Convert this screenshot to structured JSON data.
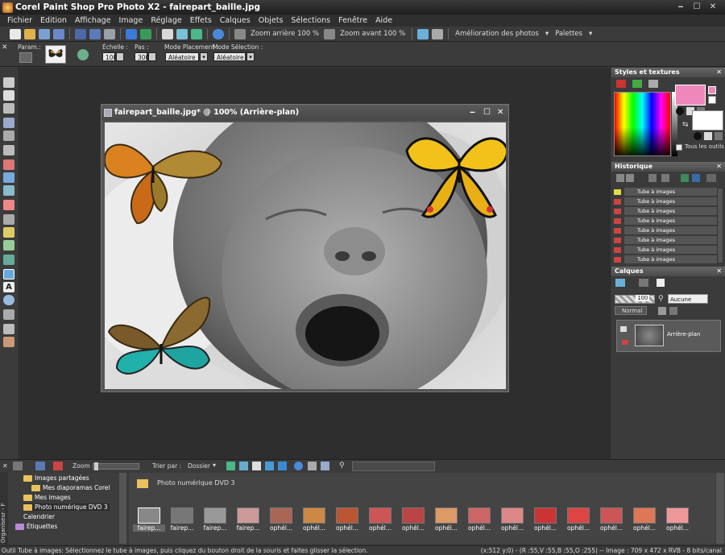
{
  "app": {
    "title": "Corel Paint Shop Pro Photo X2 - fairepart_baille.jpg"
  },
  "menu": [
    "Fichier",
    "Edition",
    "Affichage",
    "Image",
    "Réglage",
    "Effets",
    "Calques",
    "Objets",
    "Sélections",
    "Fenêtre",
    "Aide"
  ],
  "toolbar": {
    "zoom_out": "Zoom arrière 100 %",
    "zoom_in": "Zoom avant 100 %",
    "enhance": "Amélioration des photos",
    "palettes": "Palettes"
  },
  "options": {
    "param": "Param.:",
    "echelle_lbl": "Échelle :",
    "echelle_val": "100",
    "pas_lbl": "Pas :",
    "pas_val": "300",
    "placement_lbl": "Mode Placement :",
    "placement_val": "Aléatoire",
    "selection_lbl": "Mode Sélection :",
    "selection_val": "Aléatoire"
  },
  "image_window": {
    "title": "fairepart_baille.jpg* @ 100% (Arrière-plan)"
  },
  "styles": {
    "header": "Styles et textures",
    "all_tools": "Tous les outils",
    "fg_color": "#ee88bb",
    "bg_color": "#ffffff"
  },
  "history": {
    "header": "Historique",
    "items": [
      "Tube à images",
      "Tube à images",
      "Tube à images",
      "Tube à images",
      "Tube à images",
      "Tube à images",
      "Tube à images",
      "Tube à images"
    ]
  },
  "layers": {
    "header": "Calques",
    "opacity": "100",
    "mask": "Aucune",
    "blend": "Normal",
    "layer_name": "Arrière-plan"
  },
  "organizer": {
    "zoom": "Zoom",
    "sort_by": "Trier par :",
    "sort_val": "Dossier",
    "side_label": "Organiseur - F",
    "tree": [
      "Images partagées",
      "Mes diaporamas Corel",
      "Mes images",
      "Photo numérique DVD 3",
      "Calendrier",
      "Étiquettes"
    ],
    "folder": "Photo numérique DVD 3",
    "thumbs": [
      "fairep...",
      "fairep...",
      "fairep...",
      "fairep...",
      "ophél...",
      "ophél...",
      "ophél...",
      "ophél...",
      "ophél...",
      "ophél...",
      "ophél...",
      "ophél...",
      "ophél...",
      "ophél...",
      "ophél...",
      "ophél...",
      "ophél..."
    ]
  },
  "status": {
    "left": "Outil Tube à images: Sélectionnez le tube à images, puis cliquez du bouton droit de la souris et faites glisser la sélection.",
    "right": "(x:512 y:0) - (R :55,V :55,B :55,O :255) -- Image : 709 x 472 x RVB - 8 bits/canal"
  }
}
